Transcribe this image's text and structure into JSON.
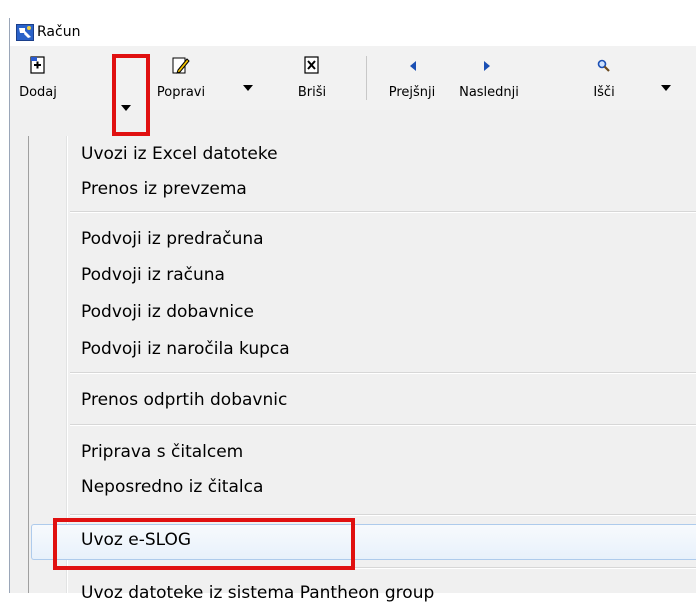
{
  "window": {
    "title": "Račun"
  },
  "toolbar": {
    "add_label": "Dodaj",
    "edit_label": "Popravi",
    "delete_label": "Briši",
    "prev_label": "Prejšnji",
    "next_label": "Naslednji",
    "search_label": "Išči"
  },
  "menu": {
    "items": [
      "Uvozi iz Excel datoteke",
      "Prenos iz prevzema",
      "Podvoji iz predračuna",
      "Podvoji iz računa",
      "Podvoji iz dobavnice",
      "Podvoji iz naročila kupca",
      "Prenos odprtih dobavnic",
      "Priprava s čitalcem",
      "Neposredno iz čitalca",
      "Uvoz e-SLOG",
      "Uvoz datoteke iz sistema Pantheon group"
    ]
  },
  "colors": {
    "highlight_box": "#e01010",
    "menu_hover": "#e8f1fb",
    "nav_arrow": "#1a4fb4"
  }
}
